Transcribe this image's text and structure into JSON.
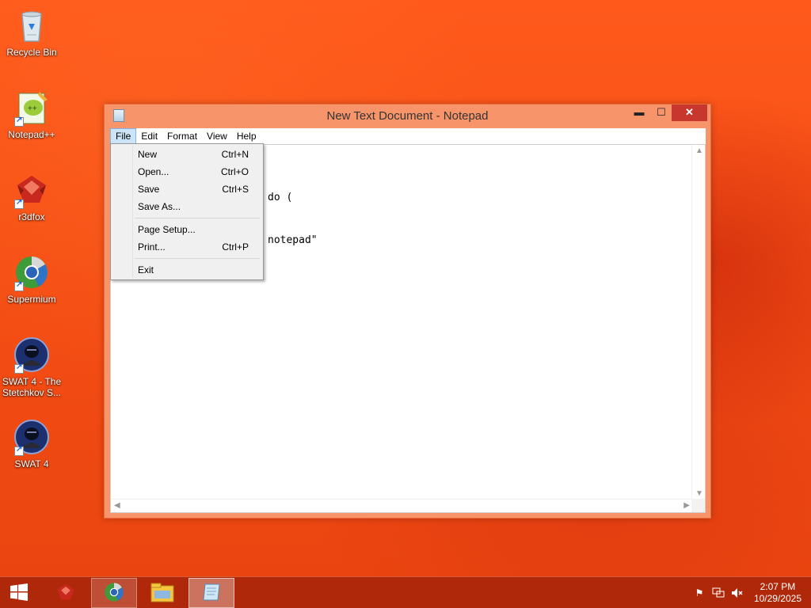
{
  "desktop": {
    "icons": [
      {
        "label": "Recycle Bin",
        "icon": "recycle-bin-icon"
      },
      {
        "label": "Notepad++",
        "icon": "notepad-plus-plus-icon"
      },
      {
        "label": "r3dfox",
        "icon": "r3dfox-icon"
      },
      {
        "label": "Supermium",
        "icon": "supermium-icon"
      },
      {
        "label": "SWAT 4 - The Stetchkov S...",
        "icon": "swat4-icon"
      },
      {
        "label": "SWAT 4",
        "icon": "swat4-icon"
      }
    ]
  },
  "window": {
    "title": "New Text Document - Notepad",
    "controls": {
      "minimize": "▬",
      "maximize": "☐",
      "close": "✕"
    },
    "menu": [
      "File",
      "Edit",
      "Format",
      "View",
      "Help"
    ],
    "active_menu": "File",
    "editor_lines": [
      "do (",
      "notepad\""
    ]
  },
  "file_menu": {
    "items": [
      {
        "label": "New",
        "shortcut": "Ctrl+N"
      },
      {
        "label": "Open...",
        "shortcut": "Ctrl+O"
      },
      {
        "label": "Save",
        "shortcut": "Ctrl+S"
      },
      {
        "label": "Save As...",
        "shortcut": ""
      },
      {
        "label": "Page Setup...",
        "shortcut": ""
      },
      {
        "label": "Print...",
        "shortcut": "Ctrl+P"
      },
      {
        "label": "Exit",
        "shortcut": ""
      }
    ]
  },
  "taskbar": {
    "start_icon": "windows-logo-icon",
    "apps": [
      {
        "icon": "r3dfox-icon",
        "state": "normal"
      },
      {
        "icon": "supermium-icon",
        "state": "pinned"
      },
      {
        "icon": "file-explorer-icon",
        "state": "normal"
      },
      {
        "icon": "notepad-icon",
        "state": "active"
      }
    ],
    "tray": [
      "action-center-flag-icon",
      "network-icon",
      "volume-muted-icon"
    ],
    "clock": {
      "time": "2:07 PM",
      "date": "10/29/2025"
    }
  },
  "colors": {
    "desktop": "#f44d14",
    "window_frame": "#f8946a",
    "close_button": "#c7372e",
    "taskbar": "#aa260a"
  }
}
